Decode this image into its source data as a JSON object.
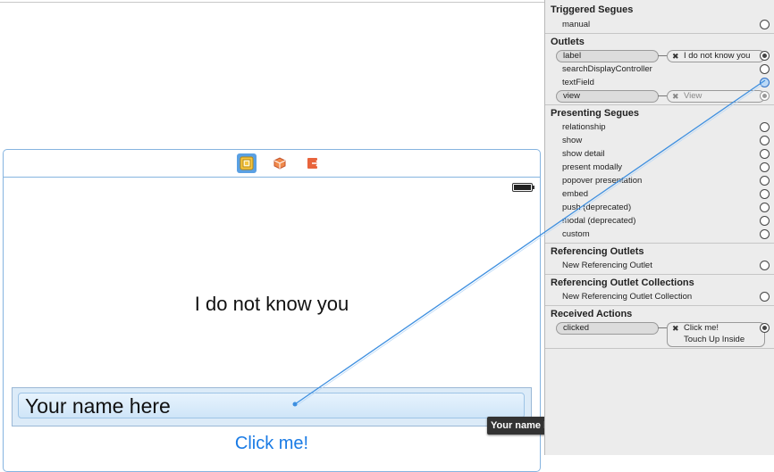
{
  "canvas": {
    "label_text": "I do not know you",
    "textfield_placeholder": "Your name here",
    "button_title": "Click me!",
    "tooltip": "Your name here",
    "dock_icons": [
      "view-controller-icon",
      "first-responder-icon",
      "exit-icon"
    ]
  },
  "inspector": {
    "triggered_segues": {
      "title": "Triggered Segues",
      "rows": [
        {
          "label": "manual"
        }
      ]
    },
    "outlets": {
      "title": "Outlets",
      "rows": [
        {
          "label": "label",
          "connected": true,
          "target": "I do not know you"
        },
        {
          "label": "searchDisplayController",
          "connected": false
        },
        {
          "label": "textField",
          "connected": false,
          "dragging": true
        },
        {
          "label": "view",
          "connected": true,
          "target": "View"
        }
      ]
    },
    "presenting_segues": {
      "title": "Presenting Segues",
      "rows": [
        {
          "label": "relationship"
        },
        {
          "label": "show"
        },
        {
          "label": "show detail"
        },
        {
          "label": "present modally"
        },
        {
          "label": "popover presentation"
        },
        {
          "label": "embed"
        },
        {
          "label": "push (deprecated)"
        },
        {
          "label": "modal (deprecated)"
        },
        {
          "label": "custom"
        }
      ]
    },
    "referencing_outlets": {
      "title": "Referencing Outlets",
      "rows": [
        {
          "label": "New Referencing Outlet"
        }
      ]
    },
    "referencing_outlet_collections": {
      "title": "Referencing Outlet Collections",
      "rows": [
        {
          "label": "New Referencing Outlet Collection"
        }
      ]
    },
    "received_actions": {
      "title": "Received Actions",
      "rows": [
        {
          "label": "clicked",
          "connected": true,
          "target": "Click me!",
          "event": "Touch Up Inside"
        }
      ]
    }
  },
  "colors": {
    "connection_line": "#3d8fe0",
    "button_blue": "#1a7be5",
    "scene_border": "#86b4e0"
  }
}
